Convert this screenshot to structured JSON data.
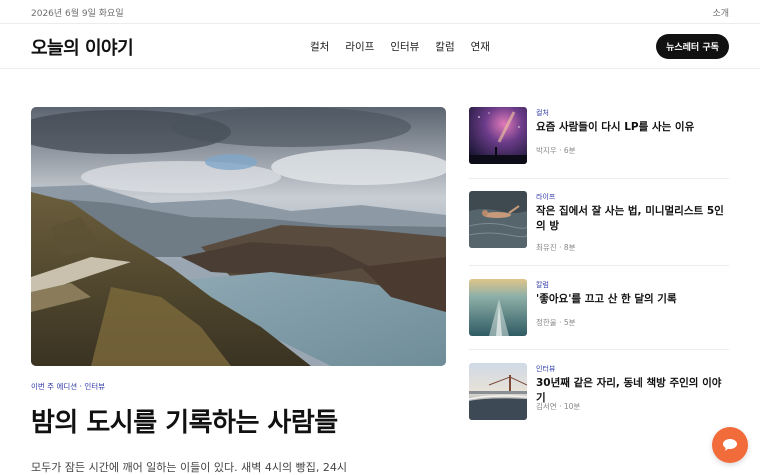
{
  "topbar": {
    "date": "2026년 6월 9일 화요일",
    "about": "소개"
  },
  "header": {
    "logo": "오늘의 이야기",
    "nav": [
      "컬처",
      "라이프",
      "인터뷰",
      "칼럼",
      "연재"
    ],
    "subscribe": "뉴스레터 구독"
  },
  "featured": {
    "category": "이번 주 에디션 · 인터뷰",
    "title": "밤의 도시를 기록하는 사람들",
    "excerpt": "모두가 잠든 시간에 깨어 일하는 이들이 있다. 새벽 4시의 빵집, 24시"
  },
  "side_articles": [
    {
      "category": "컬처",
      "title": "요즘 사람들이 다시 LP를 사는 이유",
      "meta": "박지우 · 6분",
      "thumb_icon": "night-sky-image"
    },
    {
      "category": "라이프",
      "title": "작은 집에서 잘 사는 법, 미니멀리스트 5인의 방",
      "meta": "최유진 · 8분",
      "thumb_icon": "swimmer-image"
    },
    {
      "category": "칼럼",
      "title": "'좋아요'를 끄고 산 한 달의 기록",
      "meta": "정한울 · 5분",
      "thumb_icon": "boat-wake-image"
    },
    {
      "category": "인터뷰",
      "title": "30년째 같은 자리, 동네 책방 주인의 이야기",
      "meta": "김서연 · 10분",
      "thumb_icon": "bridge-beach-image"
    }
  ],
  "chat_button": {
    "icon": "chat-bubble-icon",
    "color": "#f26b3a"
  },
  "colors": {
    "accent": "#2f3aa8",
    "dark": "#111111"
  }
}
